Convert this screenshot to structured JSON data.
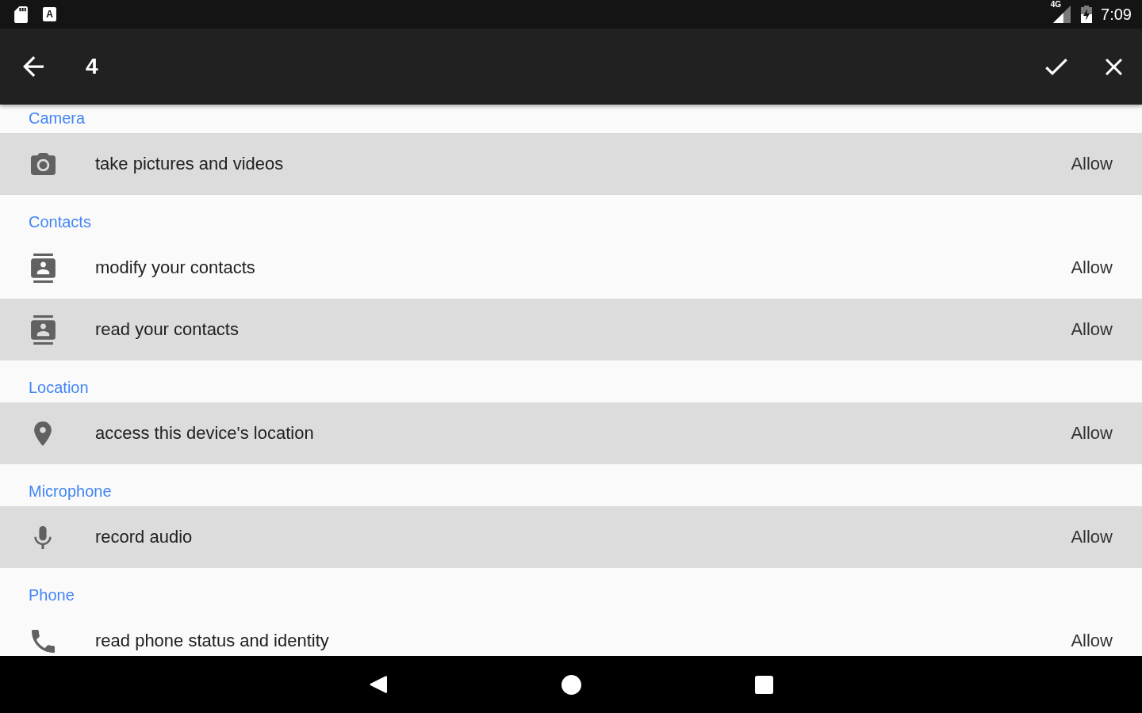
{
  "status_bar": {
    "notification_icons": [
      {
        "kind": "sd-card"
      },
      {
        "kind": "letter-tile",
        "letter": "A"
      }
    ],
    "network_type": "4G",
    "time": "7:09"
  },
  "toolbar": {
    "title": "4"
  },
  "groups": [
    {
      "title": "Camera",
      "permissions": [
        {
          "kind": "camera",
          "label": "take pictures and videos",
          "value": "Allow",
          "selected": true
        }
      ]
    },
    {
      "title": "Contacts",
      "permissions": [
        {
          "kind": "contacts",
          "label": "modify your contacts",
          "value": "Allow",
          "selected": false
        },
        {
          "kind": "contacts",
          "label": "read your contacts",
          "value": "Allow",
          "selected": true
        }
      ]
    },
    {
      "title": "Location",
      "permissions": [
        {
          "kind": "location",
          "label": "access this device's location",
          "value": "Allow",
          "selected": true
        }
      ]
    },
    {
      "title": "Microphone",
      "permissions": [
        {
          "kind": "microphone",
          "label": "record audio",
          "value": "Allow",
          "selected": true
        }
      ]
    },
    {
      "title": "Phone",
      "permissions": [
        {
          "kind": "phone",
          "label": "read phone status and identity",
          "value": "Allow",
          "selected": false
        }
      ]
    }
  ]
}
